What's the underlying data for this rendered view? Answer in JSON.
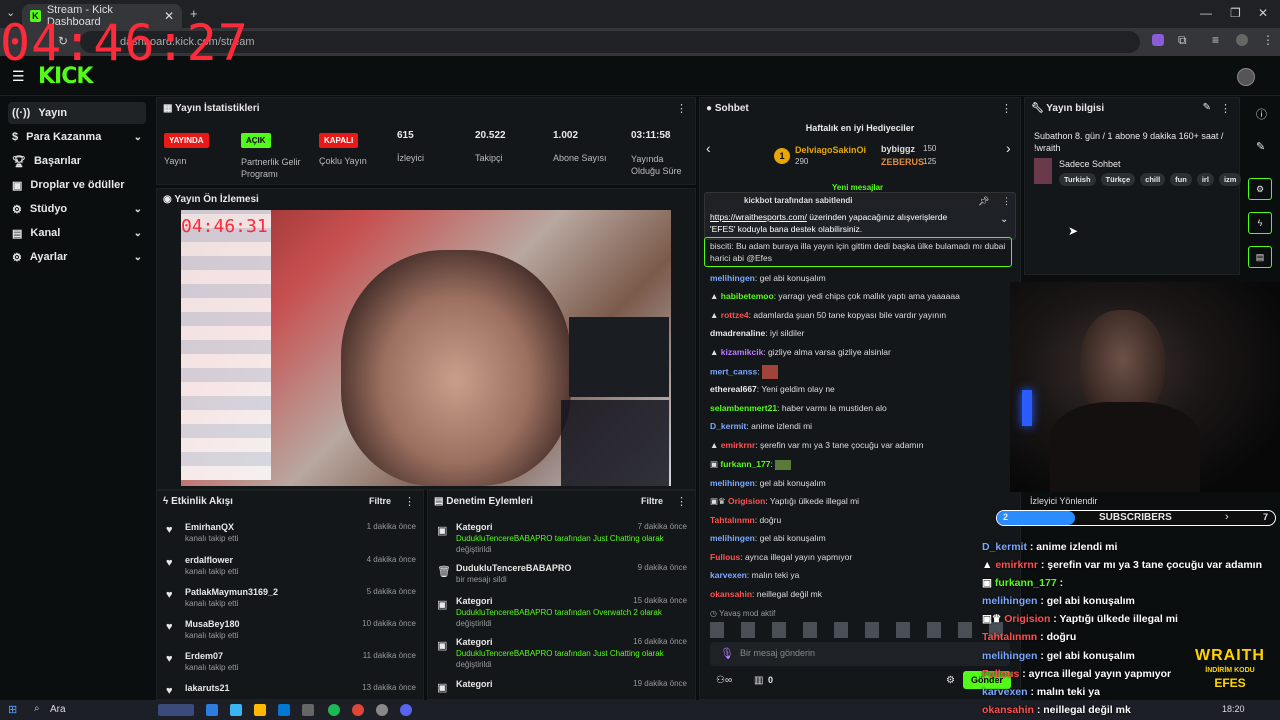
{
  "browser": {
    "tab_title": "Stream - Kick Dashboard",
    "url": "dashboard.kick.com/stream"
  },
  "overlay_clock": "04:46:27",
  "preview_clock": "04:46:31",
  "brand": {
    "logo": "KICK",
    "accent": "#53fc18"
  },
  "sidebar": {
    "items": [
      {
        "label": "Yayın",
        "icon": "broadcast-icon"
      },
      {
        "label": "Para Kazanma",
        "icon": "dollar-icon"
      },
      {
        "label": "Başarılar",
        "icon": "trophy-icon"
      },
      {
        "label": "Droplar ve ödüller",
        "icon": "gift-icon"
      },
      {
        "label": "Stüdyo",
        "icon": "studio-icon"
      },
      {
        "label": "Kanal",
        "icon": "channel-icon"
      },
      {
        "label": "Ayarlar",
        "icon": "gear-icon"
      }
    ]
  },
  "stats": {
    "title": "Yayın İstatistikleri",
    "badges": [
      {
        "badge": "YAYINDA",
        "label": "Yayın",
        "color": "#e91916"
      },
      {
        "badge": "AÇIK",
        "label": "Partnerlik Gelir Programı",
        "color": "#53fc18"
      },
      {
        "badge": "KAPALI",
        "label": "Çoklu Yayın",
        "color": "#e91916"
      }
    ],
    "numbers": [
      {
        "value": "615",
        "label": "İzleyici"
      },
      {
        "value": "20.522",
        "label": "Takipçi"
      },
      {
        "value": "1.002",
        "label": "Abone Sayısı"
      },
      {
        "value": "03:11:58",
        "label": "Yayında Olduğu Süre"
      }
    ]
  },
  "preview": {
    "title": "Yayın Ön İzlemesi"
  },
  "activity": {
    "title": "Etkinlik Akışı",
    "filter": "Filtre",
    "items": [
      {
        "name": "EmirhanQX",
        "action": "kanalı takip etti",
        "time": "1 dakika önce"
      },
      {
        "name": "erdalflower",
        "action": "kanalı takip etti",
        "time": "4 dakika önce"
      },
      {
        "name": "PatlakMaymun3169_2",
        "action": "kanalı takip etti",
        "time": "5 dakika önce"
      },
      {
        "name": "MusaBey180",
        "action": "kanalı takip etti",
        "time": "10 dakika önce"
      },
      {
        "name": "Erdem07",
        "action": "kanalı takip etti",
        "time": "11 dakika önce"
      },
      {
        "name": "lakaruts21",
        "action": "",
        "time": "13 dakika önce"
      }
    ]
  },
  "moderation": {
    "title": "Denetim Eylemleri",
    "filter": "Filtre",
    "items": [
      {
        "title": "Kategori",
        "line1": "DudukluTencereBABAPRO tarafından Just Chatting olarak",
        "line2": "değiştirildi",
        "time": "7 dakika önce"
      },
      {
        "title": "DudukluTencereBABAPRO",
        "line1": "bir mesajı sildi",
        "line2": "",
        "time": "9 dakika önce"
      },
      {
        "title": "Kategori",
        "line1": "DudukluTencereBABAPRO tarafından Overwatch 2 olarak",
        "line2": "değiştirildi",
        "time": "15 dakika önce"
      },
      {
        "title": "Kategori",
        "line1": "DudukluTencereBABAPRO tarafından Just Chatting olarak",
        "line2": "değiştirildi",
        "time": "16 dakika önce"
      },
      {
        "title": "Kategori",
        "line1": "",
        "line2": "",
        "time": "19 dakika önce"
      }
    ]
  },
  "chat": {
    "title": "Sohbet",
    "gifters_title": "Haftalık en iyi Hediyeciler",
    "gifters": [
      {
        "rank": "1",
        "name": "DelviagoSakinOi",
        "count": "290"
      },
      {
        "rank": "2",
        "name": "bybiggz",
        "count": "150"
      },
      {
        "rank": "3",
        "name": "ZEBERUS",
        "count": "125"
      }
    ],
    "new_messages": "Yeni mesajlar",
    "pinned_by": "kickbot tarafından sabitlendi",
    "pinned_link": "https://wraithesports.com/",
    "pinned_text1": " üzerinden yapacağınız alışverişlerde",
    "pinned_text2": "'EFES' koduyla bana destek olabilirsiniz.",
    "highlight1": "bisciti: Bu adam buraya illa yayın için gittim dedi başka ülke bulamadı mı dubai",
    "highlight2": "harici abi @Efes",
    "messages": [
      {
        "user": "melihingen",
        "text": ": gel abi konuşalım",
        "color": "#7aa8ff"
      },
      {
        "user": "habibetemoo",
        "text": ": yarragı yedi chips çok mallık yaptı ama yaaaaaa",
        "color": "#53fc18"
      },
      {
        "user": "rottze4",
        "text": ": adamlarda şuan 50 tane kopyası bile vardır yayının",
        "color": "#ff5050"
      },
      {
        "user": "dmadrenaline",
        "text": ": iyi sildiler",
        "color": "#e8e8e8"
      },
      {
        "user": "kizamikcik",
        "text": ": gizliye alma varsa gizliye alsinlar",
        "color": "#b97aff"
      },
      {
        "user": "mert_canss",
        "text": ":",
        "color": "#7aa8ff"
      },
      {
        "user": "ethereal667",
        "text": ": Yeni geldim olay ne",
        "color": "#e8e8e8"
      },
      {
        "user": "selambenmert21",
        "text": ": haber varmı la mustiden alo",
        "color": "#53fc18"
      },
      {
        "user": "D_kermit",
        "text": ": anime izlendi mi",
        "color": "#7aa8ff"
      },
      {
        "user": "emirkrnr",
        "text": ": şerefin var mı ya 3 tane çocuğu var adamın",
        "color": "#ff5050"
      },
      {
        "user": "furkann_177",
        "text": ":",
        "color": "#53fc18"
      },
      {
        "user": "melihingen",
        "text": ": gel abi konuşalım",
        "color": "#7aa8ff"
      },
      {
        "user": "Origision",
        "text": ": Yaptığı ülkede illegal mi",
        "color": "#ff5050"
      },
      {
        "user": "Tahtalınmn",
        "text": ": doğru",
        "color": "#ff5050"
      },
      {
        "user": "melihingen",
        "text": ": gel abi konuşalım",
        "color": "#7aa8ff"
      },
      {
        "user": "Fullous",
        "text": ": ayrıca illegal yayın yapmıyor",
        "color": "#ff5050"
      },
      {
        "user": "karvexen",
        "text": ": malın teki ya",
        "color": "#7aa8ff"
      },
      {
        "user": "okansahin",
        "text": ": neillegal değil mk",
        "color": "#ff5050"
      }
    ],
    "slow_mode": "Yavaş mod aktif",
    "input_placeholder": "Bir mesaj gönderin",
    "send": "Gönder",
    "footer_count": "0"
  },
  "stream_info": {
    "title": "Yayın bilgisi",
    "stream_title": "Subathon 8. gün / 1 abone 9 dakika 160+ saat / !wraith",
    "category": "Sadece Sohbet",
    "tags": [
      "Turkish",
      "Türkçe",
      "chill",
      "fun",
      "irl",
      "izm"
    ]
  },
  "overlay": {
    "viewer_redirect": "İzleyici Yönlendir",
    "subscribers_label": "SUBSCRIBERS",
    "sub_left": "2",
    "sub_right": "7",
    "lines": [
      {
        "user": "D_kermit",
        "text": " : anime izlendi mi",
        "color": "#7aa8ff"
      },
      {
        "user": "emirkrnr",
        "text": " : şerefin var mı ya 3 tane çocuğu var adamın",
        "color": "#ff5050"
      },
      {
        "user": "furkann_177",
        "text": " :",
        "color": "#53fc18"
      },
      {
        "user": "melihingen",
        "text": " : gel abi konuşalım",
        "color": "#7aa8ff"
      },
      {
        "user": "Origision",
        "text": " : Yaptığı ülkede illegal mi",
        "color": "#ff5050"
      },
      {
        "user": "Tahtalınmn",
        "text": " : doğru",
        "color": "#ff5050"
      },
      {
        "user": "melihingen",
        "text": " : gel abi konuşalım",
        "color": "#7aa8ff"
      },
      {
        "user": "Fullous",
        "text": " : ayrıca illegal yayın yapmıyor",
        "color": "#ff5050"
      },
      {
        "user": "karvexen",
        "text": " : malın teki ya",
        "color": "#7aa8ff"
      },
      {
        "user": "okansahin",
        "text": " : neillegal değil mk",
        "color": "#ff5050"
      }
    ],
    "sponsor_line1": "WRAITH",
    "sponsor_line2": "İNDİRİM KODU",
    "sponsor_line3": "EFES"
  },
  "taskbar": {
    "search": "Ara",
    "time": "18:20"
  }
}
